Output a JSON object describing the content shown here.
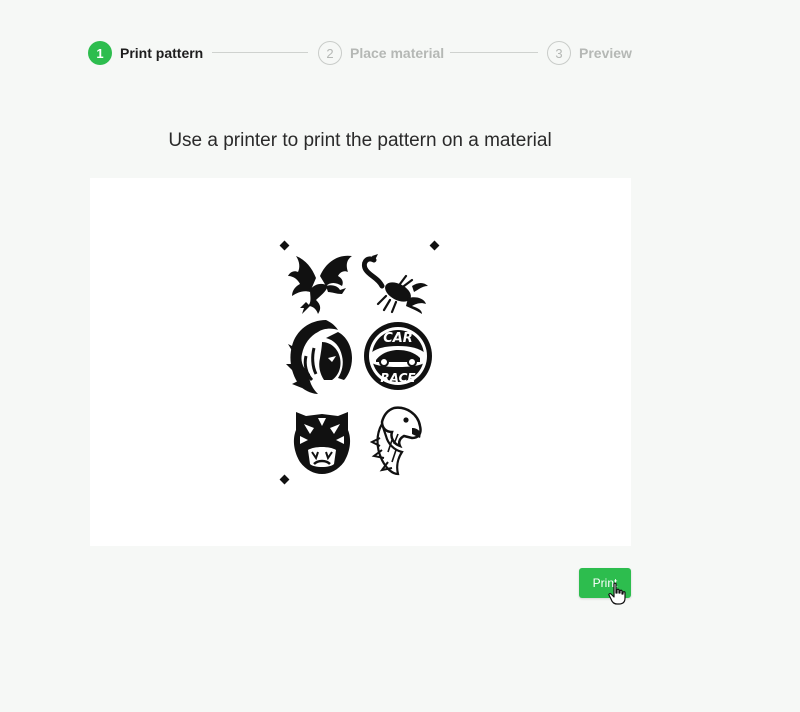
{
  "stepper": {
    "steps": [
      {
        "number": "1",
        "label": "Print pattern",
        "state": "active"
      },
      {
        "number": "2",
        "label": "Place material",
        "state": "inactive"
      },
      {
        "number": "3",
        "label": "Preview",
        "state": "inactive"
      }
    ]
  },
  "main": {
    "heading": "Use a printer to print the pattern on a material"
  },
  "preview": {
    "icons": [
      "dragon-icon",
      "scorpion-icon",
      "lion-icon",
      "car-race-badge-icon",
      "tiger-icon",
      "eagle-icon"
    ],
    "badge_text_top": "CAR",
    "badge_text_bottom": "RACE"
  },
  "actions": {
    "print_label": "Print"
  },
  "colors": {
    "accent": "#2dbd4e",
    "background": "#f6f8f6",
    "card": "#ffffff",
    "inactive": "#b5b8b5"
  }
}
